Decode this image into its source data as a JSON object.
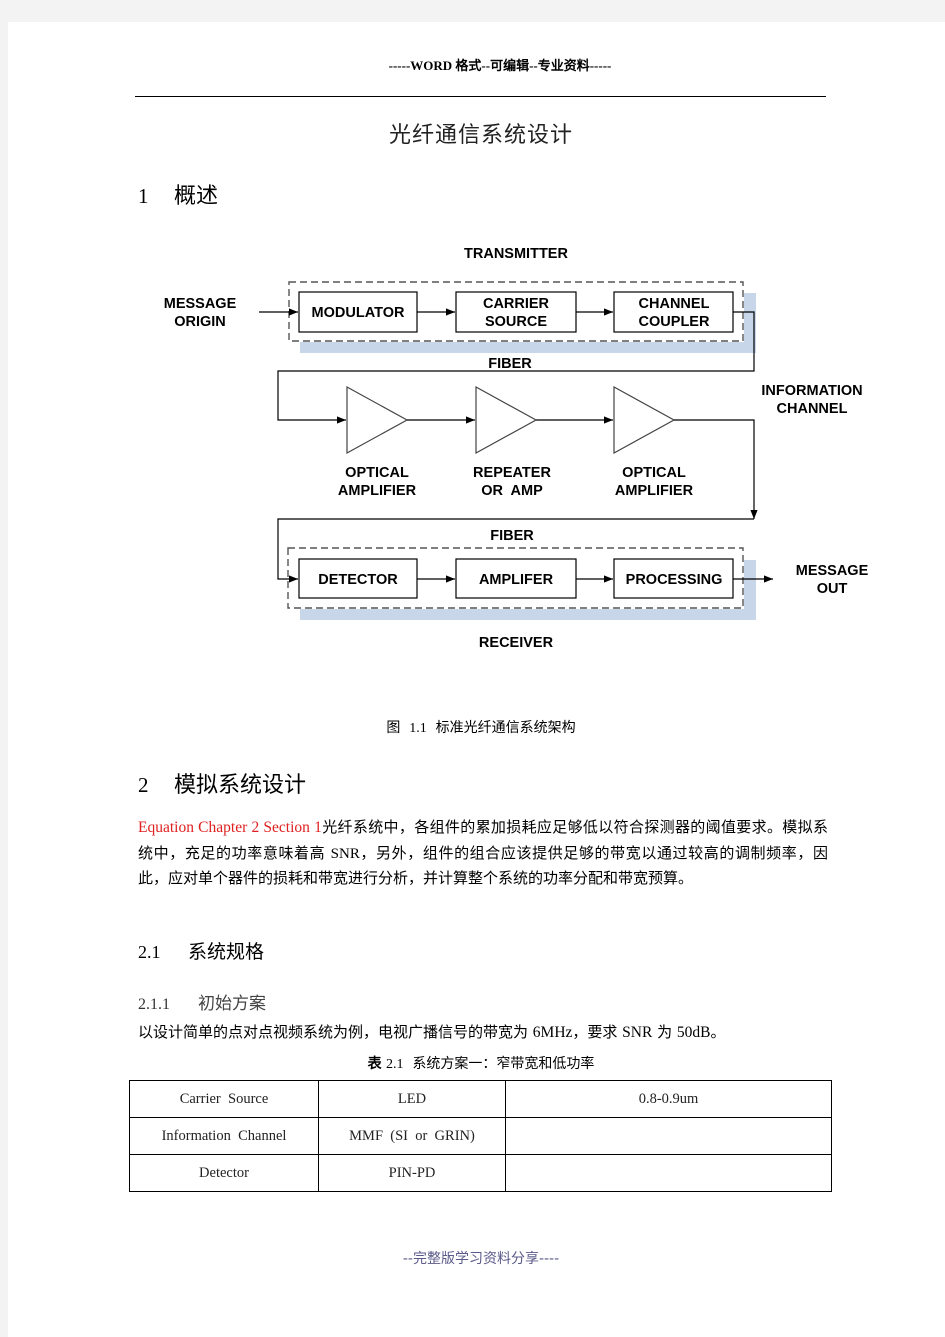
{
  "header": {
    "text": "-----WORD 格式--可编辑--专业资料-----"
  },
  "title": "光纤通信系统设计",
  "section1": {
    "number": "1",
    "title": "概述"
  },
  "diagram": {
    "transmitter_label": "TRANSMITTER",
    "receiver_label": "RECEIVER",
    "message_origin": [
      "MESSAGE",
      "ORIGIN"
    ],
    "message_out": [
      "MESSAGE",
      "OUT"
    ],
    "information_channel": [
      "INFORMATION",
      "CHANNEL"
    ],
    "fiber_top": "FIBER",
    "fiber_bottom": "FIBER",
    "tx_blocks": [
      {
        "lines": [
          "MODULATOR"
        ]
      },
      {
        "lines": [
          "CARRIER",
          "SOURCE"
        ]
      },
      {
        "lines": [
          "CHANNEL",
          "COUPLER"
        ]
      }
    ],
    "amplifiers": [
      {
        "lines": [
          "OPTICAL",
          "AMPLIFIER"
        ]
      },
      {
        "lines": [
          "REPEATER",
          "OR  AMP"
        ]
      },
      {
        "lines": [
          "OPTICAL",
          "AMPLIFIER"
        ]
      }
    ],
    "rx_blocks": [
      {
        "lines": [
          "DETECTOR"
        ]
      },
      {
        "lines": [
          "AMPLIFER"
        ]
      },
      {
        "lines": [
          "PROCESSING"
        ]
      }
    ],
    "shadow_color": "#c8d6ea"
  },
  "figure_caption": {
    "prefix": "图",
    "number": "1.1",
    "text": "标准光纤通信系统架构"
  },
  "section2": {
    "number": "2",
    "title": "模拟系统设计"
  },
  "paragraph": {
    "field_code": "Equation Chapter 2 Section 1",
    "text_part1": "光纤系统中，各组件的累加损耗应足够低以符合探测器的阈值要求。模拟系统中，充足的功率意味着高 ",
    "snr": "SNR",
    "text_part2": "，另外，组件的组合应该提供足够的带宽以通过较高的调制频率，因此，应对单个器件的损耗和带宽进行分析，并计算整个系统的功率分配和带宽预算。"
  },
  "section2_1": {
    "number": "2.1",
    "title": "系统规格"
  },
  "section2_1_1": {
    "number": "2.1.1",
    "title": "初始方案"
  },
  "intro_line": {
    "p1": "以设计简单的点对点视频系统为例，电视广播信号的带宽为 ",
    "bw": "6MHz",
    "p2": "，要求 ",
    "snr": "SNR",
    "p3": " 为 ",
    "snr_value": "50dB",
    "p4": "。"
  },
  "table_caption": {
    "prefix": "表",
    "number": "2.1",
    "text": "系统方案一：窄带宽和低功率"
  },
  "table": {
    "rows": [
      [
        "Carrier  Source",
        "LED",
        "0.8-0.9um"
      ],
      [
        "Information  Channel",
        "MMF  (SI  or  GRIN)",
        ""
      ],
      [
        "Detector",
        "PIN-PD",
        ""
      ]
    ]
  },
  "footer": {
    "text": "--完整版学习资料分享----"
  }
}
